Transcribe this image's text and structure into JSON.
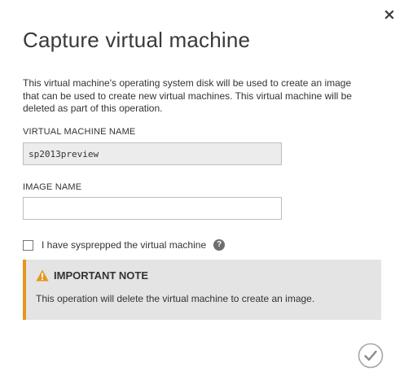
{
  "dialog": {
    "title": "Capture virtual machine",
    "description": "This virtual machine's operating system disk will be used to create an image that can be used to create new virtual machines. This virtual machine will be deleted as part of this operation.",
    "close_icon": "close-icon"
  },
  "form": {
    "vm_name_label": "VIRTUAL MACHINE NAME",
    "vm_name_value": "sp2013preview",
    "image_name_label": "IMAGE NAME",
    "image_name_value": "",
    "sysprep_label": "I have sysprepped the virtual machine",
    "sysprep_checked": false,
    "help_icon": "?"
  },
  "note": {
    "title": "IMPORTANT NOTE",
    "body": "This operation will delete the virtual machine to create an image.",
    "icon": "warning-icon",
    "accent_color": "#e8951f"
  },
  "footer": {
    "confirm_icon": "checkmark-icon"
  },
  "colors": {
    "readonly_field_bg": "#ececec",
    "note_bg": "#e4e4e4"
  }
}
